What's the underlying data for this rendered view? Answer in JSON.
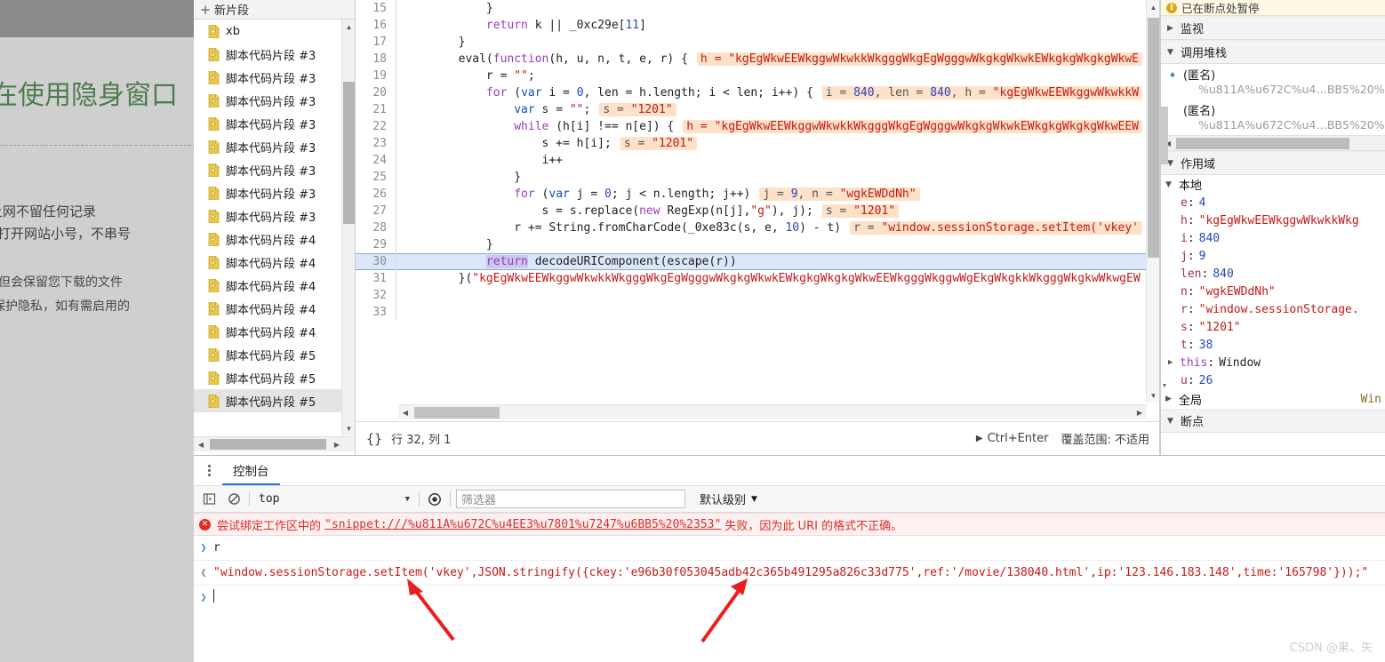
{
  "incognito": {
    "title": "正在使用隐身窗口",
    "line1": "上网不留任何记录",
    "line2": "再打开网站小号，不串号",
    "line3": "迹，但会保留您下载的文件",
    "line4": "展以保护隐私，如有需启用的"
  },
  "navigator": {
    "new_snippet_label": "新片段",
    "plus_icon": "+",
    "items": [
      {
        "label": "xb",
        "selected": false,
        "running": true
      },
      {
        "label": "脚本代码片段 #3",
        "selected": false
      },
      {
        "label": "脚本代码片段 #3",
        "selected": false
      },
      {
        "label": "脚本代码片段 #3",
        "selected": false
      },
      {
        "label": "脚本代码片段 #3",
        "selected": false
      },
      {
        "label": "脚本代码片段 #3",
        "selected": false
      },
      {
        "label": "脚本代码片段 #3",
        "selected": false
      },
      {
        "label": "脚本代码片段 #3",
        "selected": false
      },
      {
        "label": "脚本代码片段 #3",
        "selected": false
      },
      {
        "label": "脚本代码片段 #4",
        "selected": false
      },
      {
        "label": "脚本代码片段 #4",
        "selected": false
      },
      {
        "label": "脚本代码片段 #4",
        "selected": false
      },
      {
        "label": "脚本代码片段 #4",
        "selected": false
      },
      {
        "label": "脚本代码片段 #4",
        "selected": false
      },
      {
        "label": "脚本代码片段 #5",
        "selected": false
      },
      {
        "label": "脚本代码片段 #5",
        "selected": false
      },
      {
        "label": "脚本代码片段 #5",
        "selected": true
      }
    ]
  },
  "editor": {
    "lines": [
      {
        "n": "15",
        "tokens": [
          {
            "t": "            }",
            "c": "tok-plain"
          }
        ]
      },
      {
        "n": "16",
        "tokens": [
          {
            "t": "            ",
            "c": "tok-plain"
          },
          {
            "t": "return",
            "c": "tok-kw"
          },
          {
            "t": " k ",
            "c": "tok-plain"
          },
          {
            "t": "||",
            "c": "tok-plain"
          },
          {
            "t": " _0xc29e[",
            "c": "tok-plain"
          },
          {
            "t": "11",
            "c": "tok-num"
          },
          {
            "t": "]",
            "c": "tok-plain"
          }
        ]
      },
      {
        "n": "17",
        "tokens": [
          {
            "t": "        }",
            "c": "tok-plain"
          }
        ]
      },
      {
        "n": "18",
        "tokens": [
          {
            "t": "        eval(",
            "c": "tok-plain"
          },
          {
            "t": "function",
            "c": "tok-kw"
          },
          {
            "t": "(h, u, n, t, e, r) {",
            "c": "tok-plain"
          }
        ],
        "hint": "h = \"kgEgWkwEEWkggwWkwkkWkgggWkgEgWgggwWkgkgWkwkEWkgkgWkgkgWkwE",
        "hint_str": true
      },
      {
        "n": "19",
        "tokens": [
          {
            "t": "            r ",
            "c": "tok-plain"
          },
          {
            "t": "= ",
            "c": "tok-plain"
          },
          {
            "t": "\"\"",
            "c": "tok-str"
          },
          {
            "t": ";",
            "c": "tok-plain"
          }
        ]
      },
      {
        "n": "20",
        "tokens": [
          {
            "t": "            ",
            "c": "tok-plain"
          },
          {
            "t": "for",
            "c": "tok-kw"
          },
          {
            "t": " (",
            "c": "tok-plain"
          },
          {
            "t": "var",
            "c": "tok-kw2"
          },
          {
            "t": " i = ",
            "c": "tok-plain"
          },
          {
            "t": "0",
            "c": "tok-num"
          },
          {
            "t": ", len = h.length; i < len; i++) {",
            "c": "tok-plain"
          }
        ],
        "hint_kv": [
          {
            "k": "i = ",
            "v": "840",
            "vt": "num"
          },
          {
            "k": ", len = ",
            "v": "840",
            "vt": "num"
          },
          {
            "k": ", h = ",
            "v": "\"kgEgWkwEEWkggwWkwkkW",
            "vt": "str"
          }
        ]
      },
      {
        "n": "21",
        "tokens": [
          {
            "t": "                ",
            "c": "tok-plain"
          },
          {
            "t": "var",
            "c": "tok-kw2"
          },
          {
            "t": " s = ",
            "c": "tok-plain"
          },
          {
            "t": "\"\"",
            "c": "tok-str"
          },
          {
            "t": ";",
            "c": "tok-plain"
          }
        ],
        "hint_kv": [
          {
            "k": "s = ",
            "v": "\"1201\"",
            "vt": "str"
          }
        ]
      },
      {
        "n": "22",
        "tokens": [
          {
            "t": "                ",
            "c": "tok-plain"
          },
          {
            "t": "while",
            "c": "tok-kw"
          },
          {
            "t": " (h[i] !== n[e]) {",
            "c": "tok-plain"
          }
        ],
        "hint": "h = \"kgEgWkwEEWkggwWkwkkWkgggWkgEgWgggwWkgkgWkwkEWkgkgWkgkgWkwEEW",
        "hint_str": true
      },
      {
        "n": "23",
        "tokens": [
          {
            "t": "                    s += h[i];",
            "c": "tok-plain"
          }
        ],
        "hint_kv": [
          {
            "k": "s = ",
            "v": "\"1201\"",
            "vt": "str"
          }
        ]
      },
      {
        "n": "24",
        "tokens": [
          {
            "t": "                    i++",
            "c": "tok-plain"
          }
        ]
      },
      {
        "n": "25",
        "tokens": [
          {
            "t": "                }",
            "c": "tok-plain"
          }
        ]
      },
      {
        "n": "26",
        "tokens": [
          {
            "t": "                ",
            "c": "tok-plain"
          },
          {
            "t": "for",
            "c": "tok-kw"
          },
          {
            "t": " (",
            "c": "tok-plain"
          },
          {
            "t": "var",
            "c": "tok-kw2"
          },
          {
            "t": " j = ",
            "c": "tok-plain"
          },
          {
            "t": "0",
            "c": "tok-num"
          },
          {
            "t": "; j < n.length; j++)",
            "c": "tok-plain"
          }
        ],
        "hint_kv": [
          {
            "k": "j = ",
            "v": "9",
            "vt": "num"
          },
          {
            "k": ", n = ",
            "v": "\"wgkEWDdNh\"",
            "vt": "str"
          }
        ]
      },
      {
        "n": "27",
        "tokens": [
          {
            "t": "                    s = s.replace(",
            "c": "tok-plain"
          },
          {
            "t": "new",
            "c": "tok-kw"
          },
          {
            "t": " RegExp(n[j],",
            "c": "tok-plain"
          },
          {
            "t": "\"g\"",
            "c": "tok-str"
          },
          {
            "t": "), j);",
            "c": "tok-plain"
          }
        ],
        "hint_kv": [
          {
            "k": "s = ",
            "v": "\"1201\"",
            "vt": "str"
          }
        ]
      },
      {
        "n": "28",
        "tokens": [
          {
            "t": "                r += String.fromCharCode(_0xe83c(s, e, ",
            "c": "tok-plain"
          },
          {
            "t": "10",
            "c": "tok-num"
          },
          {
            "t": ") - t)",
            "c": "tok-plain"
          }
        ],
        "hint_kv": [
          {
            "k": "r = ",
            "v": "\"window.sessionStorage.setItem('vkey'",
            "vt": "str"
          }
        ]
      },
      {
        "n": "29",
        "tokens": [
          {
            "t": "            }",
            "c": "tok-plain"
          }
        ]
      },
      {
        "n": "30",
        "current": true,
        "tokens": [
          {
            "t": "            ",
            "c": "tok-plain"
          },
          {
            "t": "return",
            "c": "tok-sel"
          },
          {
            "t": " decodeURIComponent(escape(r))",
            "c": "tok-plain"
          }
        ]
      },
      {
        "n": "31",
        "tokens": [
          {
            "t": "        }(",
            "c": "tok-plain"
          },
          {
            "t": "\"kgEgWkwEEWkggwWkwkkWkgggWkgEgWgggwWkgkgWkwkEWkgkgWkgkgWkwEEWkgggWkggwWgEkgWkgkkWkgggWkgkwWkwgEW",
            "c": "tok-str"
          }
        ]
      },
      {
        "n": "32",
        "tokens": [
          {
            "t": "",
            "c": "tok-plain"
          }
        ]
      },
      {
        "n": "33",
        "tokens": [
          {
            "t": "",
            "c": "tok-plain"
          }
        ]
      }
    ],
    "status": {
      "format_icon": "{}",
      "position": "行 32, 列 1",
      "run_shortcut": "Ctrl+Enter",
      "coverage": "覆盖范围: 不适用"
    }
  },
  "debugger": {
    "paused_banner": "已在断点处暂停",
    "sections": {
      "watch": "监视",
      "call_stack": "调用堆栈",
      "scope": "作用域",
      "breakpoints": "断点"
    },
    "call_stack": [
      {
        "name": "(匿名)",
        "url": "%u811A%u672C%u4…BB5%20%2353",
        "active": true
      },
      {
        "name": "(匿名)",
        "url": "%u811A%u672C%u4…BB5%20%2353",
        "active": false
      }
    ],
    "scope_local_label": "本地",
    "scope_global_label": "全局",
    "scope_global_value": "Win",
    "variables": [
      {
        "name": "e",
        "value": "4",
        "type": "num"
      },
      {
        "name": "h",
        "value": "\"kgEgWkwEEWkggwWkwkkWkg",
        "type": "str"
      },
      {
        "name": "i",
        "value": "840",
        "type": "num"
      },
      {
        "name": "j",
        "value": "9",
        "type": "num"
      },
      {
        "name": "len",
        "value": "840",
        "type": "num"
      },
      {
        "name": "n",
        "value": "\"wgkEWDdNh\"",
        "type": "str"
      },
      {
        "name": "r",
        "value": "\"window.sessionStorage.",
        "type": "str"
      },
      {
        "name": "s",
        "value": "\"1201\"",
        "type": "str"
      },
      {
        "name": "t",
        "value": "38",
        "type": "num"
      },
      {
        "name": "this",
        "value": "Window",
        "type": "obj",
        "expandable": true,
        "keyword": true
      },
      {
        "name": "u",
        "value": "26",
        "type": "num"
      }
    ]
  },
  "console": {
    "tab_label": "控制台",
    "context": "top",
    "filter_placeholder": "筛选器",
    "level_label": "默认级别",
    "error": {
      "prefix": "尝试绑定工作区中的",
      "link": "\"snippet:///%u811A%u672C%u4EE3%u7801%u7247%u6BB5%20%2353\"",
      "suffix": "失败，因为此 URI 的格式不正确。"
    },
    "messages": [
      {
        "kind": "input",
        "chevron": "❯",
        "text": "r"
      },
      {
        "kind": "result",
        "chevron": "❮",
        "text": "\"window.sessionStorage.setItem('vkey',JSON.stringify({ckey:'e96b30f053045adb42c365b491295a826c33d775',ref:'/movie/138040.html',ip:'123.146.183.148',time:'165798'}));\""
      }
    ],
    "prompt_chevron": "❯"
  },
  "watermark": "CSDN @果、失"
}
